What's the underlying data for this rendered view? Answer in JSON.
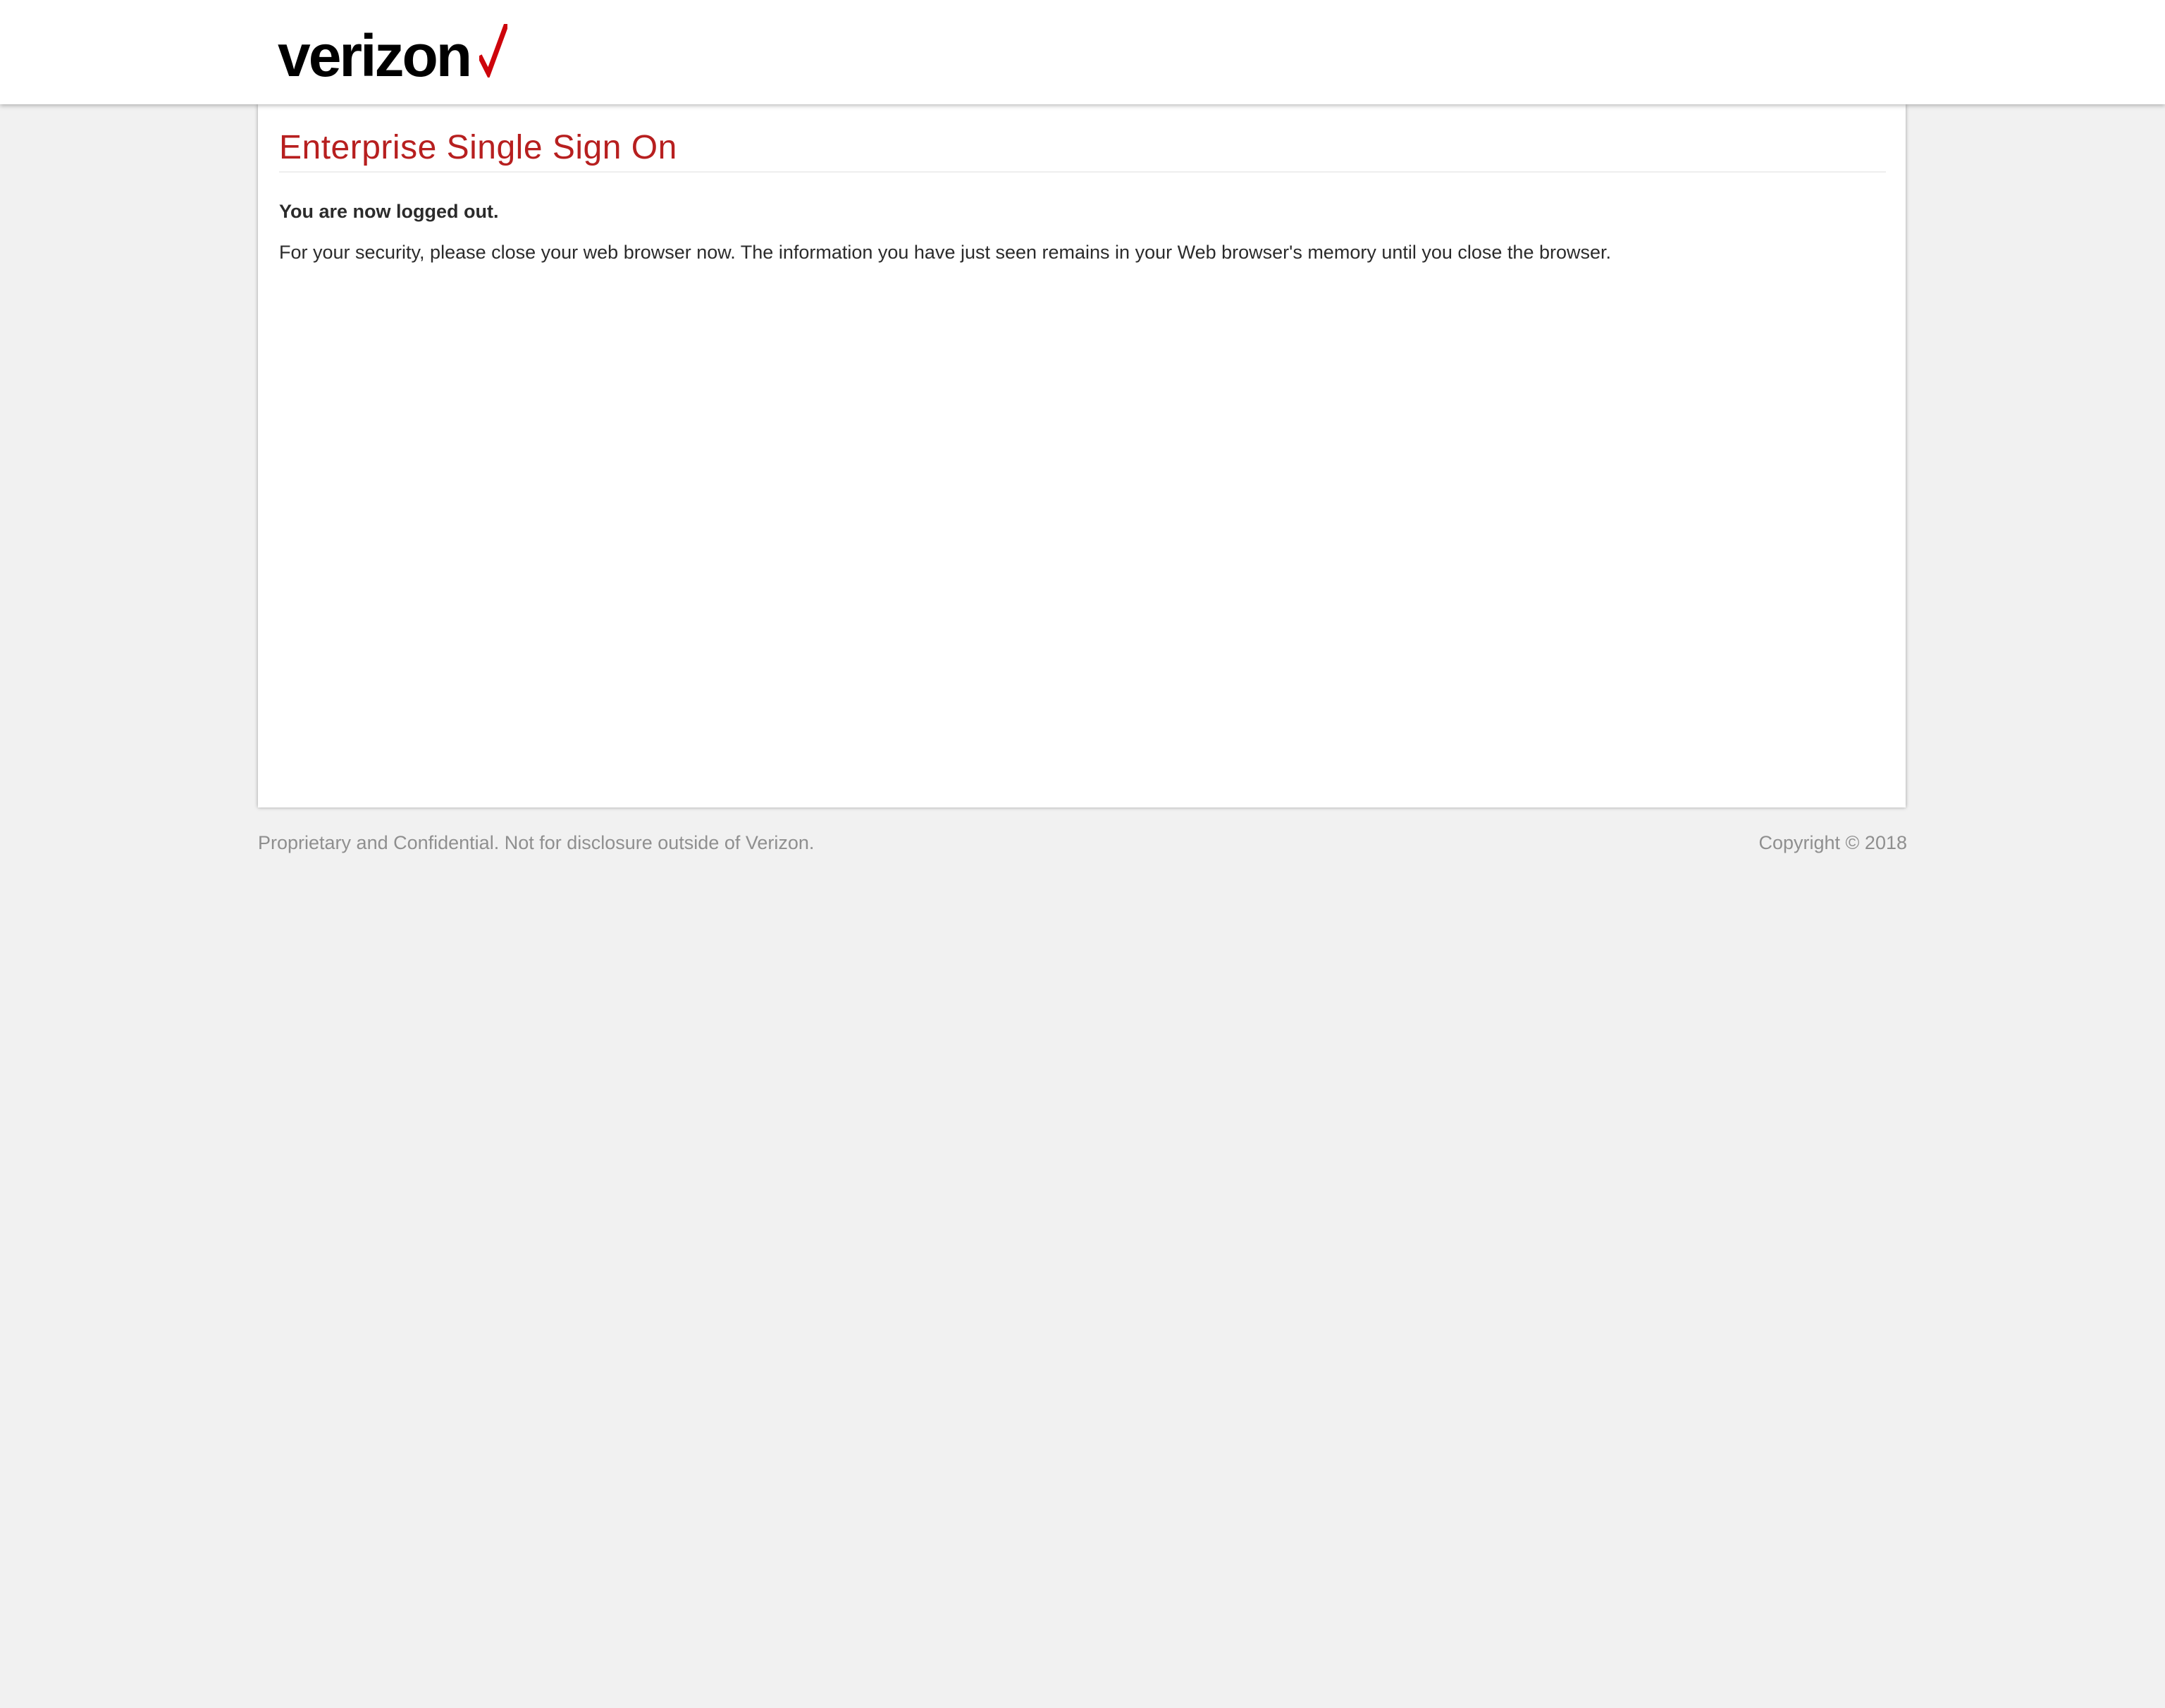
{
  "header": {
    "logo_text": "verizon",
    "logo_icon": "red-checkmark-icon"
  },
  "main": {
    "title": "Enterprise Single Sign On",
    "logout_heading": "You are now logged out.",
    "security_message": "For your security, please close your web browser now. The information you have just seen remains in your Web browser's memory until you close the browser."
  },
  "footer": {
    "confidential_notice": "Proprietary and Confidential. Not for disclosure outside of Verizon.",
    "copyright": "Copyright © 2018"
  },
  "colors": {
    "brand_red": "#b71f1f",
    "background": "#f1f1f1",
    "text": "#2b2b2b",
    "footer_text": "#8f8f8f"
  }
}
